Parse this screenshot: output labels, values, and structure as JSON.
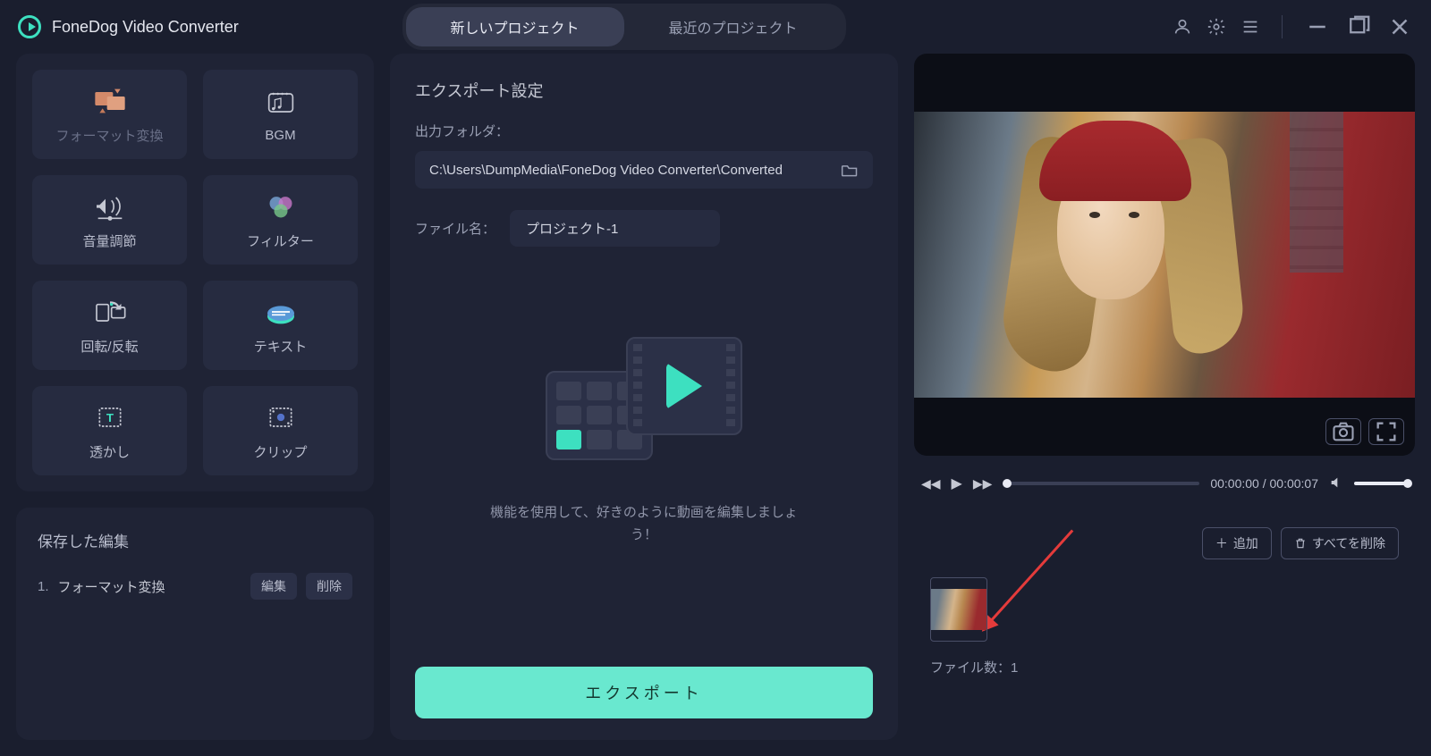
{
  "app": {
    "title": "FoneDog Video Converter"
  },
  "tabs": {
    "new_project": "新しいプロジェクト",
    "recent_projects": "最近のプロジェクト"
  },
  "sidebar": {
    "tools": [
      {
        "label": "フォーマット変換",
        "name": "tool-format-convert",
        "icon": "convert-icon",
        "muted": true
      },
      {
        "label": "BGM",
        "name": "tool-bgm",
        "icon": "bgm-icon",
        "muted": false
      },
      {
        "label": "音量調節",
        "name": "tool-volume",
        "icon": "volume-icon",
        "muted": false
      },
      {
        "label": "フィルター",
        "name": "tool-filter",
        "icon": "filter-icon",
        "muted": false
      },
      {
        "label": "回転/反転",
        "name": "tool-rotate-flip",
        "icon": "rotate-icon",
        "muted": false
      },
      {
        "label": "テキスト",
        "name": "tool-text",
        "icon": "text-icon",
        "muted": false
      },
      {
        "label": "透かし",
        "name": "tool-watermark",
        "icon": "watermark-icon",
        "muted": false
      },
      {
        "label": "クリップ",
        "name": "tool-clip",
        "icon": "clip-icon",
        "muted": false
      }
    ],
    "saved_title": "保存した編集",
    "saved": [
      {
        "index": "1.",
        "label": "フォーマット変換"
      }
    ],
    "edit_btn": "編集",
    "delete_btn": "削除"
  },
  "export": {
    "section_title": "エクスポート設定",
    "output_folder_label": "出力フォルダ：",
    "output_folder_path": "C:\\Users\\DumpMedia\\FoneDog Video Converter\\Converted",
    "filename_label": "ファイル名：",
    "filename_value": "プロジェクト-1",
    "hero_text": "機能を使用して、好きのように動画を編集しましょう！",
    "export_button": "エクスポート"
  },
  "preview": {
    "time_current": "00:00:00",
    "time_total": "00:00:07"
  },
  "files": {
    "add_btn": "追加",
    "delete_all_btn": "すべてを削除",
    "count_label": "ファイル数：",
    "count_value": "1"
  },
  "colors": {
    "accent": "#3de0c0",
    "export_button": "#69e8cf",
    "bg": "#1a1e2e",
    "panel": "#1f2335"
  }
}
